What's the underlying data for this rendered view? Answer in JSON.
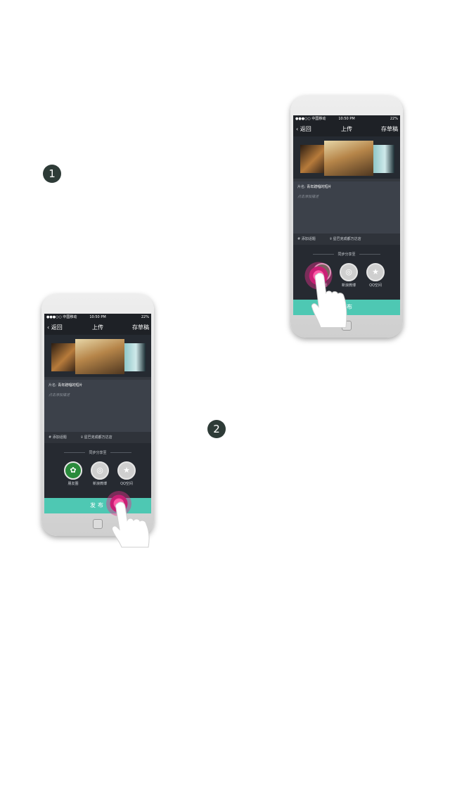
{
  "steps": [
    "1",
    "2"
  ],
  "phone": {
    "status": {
      "carrier": "●●●○○ 中国移动 ",
      "time": "10:50 PM",
      "battery": "22%"
    },
    "nav": {
      "back": "返回",
      "title": "上传",
      "draft": "存草稿"
    },
    "form": {
      "name_label": "片名:",
      "name_value": "青年蹭唱的短片",
      "desc_placeholder": "点击添加描述"
    },
    "tags": {
      "topic": "添加话题",
      "location": "星巴克成都万达店"
    },
    "share": {
      "label": "同步分享至",
      "options": [
        {
          "label": "朋友圈",
          "icon": "moments-icon"
        },
        {
          "label": "新浪微博",
          "icon": "weibo-icon"
        },
        {
          "label": "QQ空间",
          "icon": "qzone-icon"
        }
      ]
    },
    "publish_label": "发布"
  },
  "colors": {
    "accent": "#4ec8b3",
    "ripple": "#e0308a",
    "screen_bg": "#34383f",
    "badge": "#2e3b37"
  }
}
